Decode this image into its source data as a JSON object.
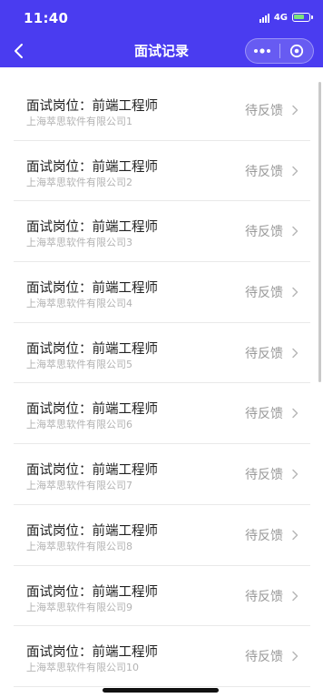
{
  "status_bar": {
    "time": "11:40",
    "network": "4G",
    "battery_level": 0.75,
    "battery_color": "#7be37b"
  },
  "nav": {
    "title": "面试记录",
    "background_color": "#4a3cf0"
  },
  "list": {
    "items": [
      {
        "title": "面试岗位：前端工程师",
        "company": "上海萃思软件有限公司1",
        "status": "待反馈"
      },
      {
        "title": "面试岗位：前端工程师",
        "company": "上海萃思软件有限公司2",
        "status": "待反馈"
      },
      {
        "title": "面试岗位：前端工程师",
        "company": "上海萃思软件有限公司3",
        "status": "待反馈"
      },
      {
        "title": "面试岗位：前端工程师",
        "company": "上海萃思软件有限公司4",
        "status": "待反馈"
      },
      {
        "title": "面试岗位：前端工程师",
        "company": "上海萃思软件有限公司5",
        "status": "待反馈"
      },
      {
        "title": "面试岗位：前端工程师",
        "company": "上海萃思软件有限公司6",
        "status": "待反馈"
      },
      {
        "title": "面试岗位：前端工程师",
        "company": "上海萃思软件有限公司7",
        "status": "待反馈"
      },
      {
        "title": "面试岗位：前端工程师",
        "company": "上海萃思软件有限公司8",
        "status": "待反馈"
      },
      {
        "title": "面试岗位：前端工程师",
        "company": "上海萃思软件有限公司9",
        "status": "待反馈"
      },
      {
        "title": "面试岗位：前端工程师",
        "company": "上海萃思软件有限公司10",
        "status": "待反馈"
      }
    ]
  },
  "icons": {
    "back": "chevron-left-icon",
    "more": "more-dots-icon",
    "close": "target-close-icon",
    "row_arrow": "chevron-right-icon"
  }
}
